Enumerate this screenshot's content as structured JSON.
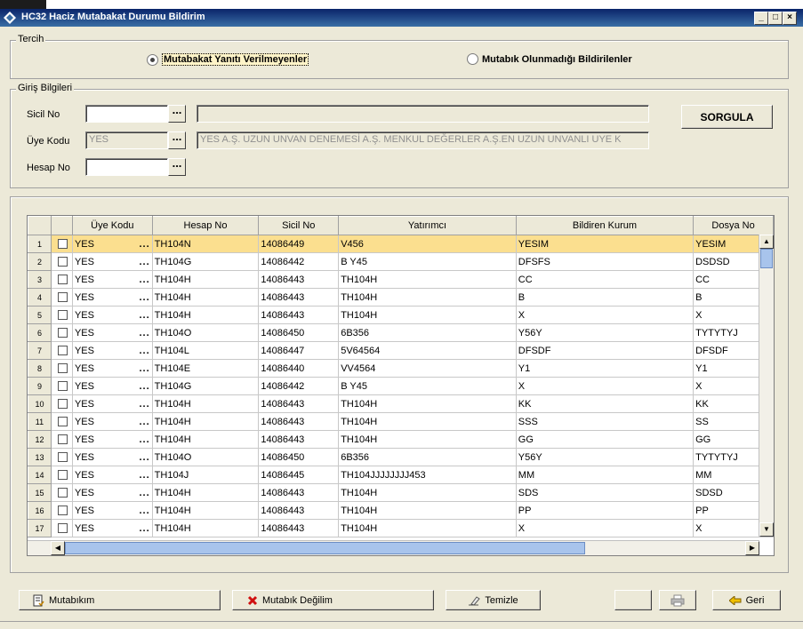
{
  "window": {
    "title": "HC32 Haciz Mutabakat Durumu Bildirim"
  },
  "tercih": {
    "legend": "Tercih",
    "option1": "Mutabakat Yanıtı Verilmeyenler",
    "option2": "Mutabık Olunmadığı Bildirilenler"
  },
  "giris": {
    "legend": "Giriş Bilgileri",
    "sicil_label": "Sicil No",
    "sicil_value": "",
    "sicil_desc": "",
    "uye_label": "Üye Kodu",
    "uye_value": "YES",
    "uye_desc": "YES A.Ş. UZUN UNVAN DENEMESİ A.Ş. MENKUL DEĞERLER A.Ş.EN UZUN UNVANLI UYE K",
    "hesap_label": "Hesap No",
    "hesap_value": "",
    "dots": "...",
    "sorgula": "SORGULA"
  },
  "grid": {
    "columns": [
      "Üye Kodu",
      "Hesap No",
      "Sicil No",
      "Yatırımcı",
      "Bildiren Kurum",
      "Dosya No"
    ],
    "rows": [
      {
        "n": "1",
        "uye": "YES",
        "hesap": "TH104N",
        "sicil": "14086449",
        "yatirimci": "V456",
        "kurum": "YESIM",
        "dosya": "YESIM"
      },
      {
        "n": "2",
        "uye": "YES",
        "hesap": "TH104G",
        "sicil": "14086442",
        "yatirimci": "B Y45",
        "kurum": "DFSFS",
        "dosya": "DSDSD"
      },
      {
        "n": "3",
        "uye": "YES",
        "hesap": "TH104H",
        "sicil": "14086443",
        "yatirimci": "TH104H",
        "kurum": "CC",
        "dosya": "CC"
      },
      {
        "n": "4",
        "uye": "YES",
        "hesap": "TH104H",
        "sicil": "14086443",
        "yatirimci": "TH104H",
        "kurum": "B",
        "dosya": "B"
      },
      {
        "n": "5",
        "uye": "YES",
        "hesap": "TH104H",
        "sicil": "14086443",
        "yatirimci": "TH104H",
        "kurum": "X",
        "dosya": "X"
      },
      {
        "n": "6",
        "uye": "YES",
        "hesap": "TH104O",
        "sicil": "14086450",
        "yatirimci": "6B356",
        "kurum": "Y56Y",
        "dosya": "TYTYTYJ"
      },
      {
        "n": "7",
        "uye": "YES",
        "hesap": "TH104L",
        "sicil": "14086447",
        "yatirimci": "5V64564",
        "kurum": "DFSDF",
        "dosya": "DFSDF"
      },
      {
        "n": "8",
        "uye": "YES",
        "hesap": "TH104E",
        "sicil": "14086440",
        "yatirimci": "VV4564",
        "kurum": "Y1",
        "dosya": "Y1"
      },
      {
        "n": "9",
        "uye": "YES",
        "hesap": "TH104G",
        "sicil": "14086442",
        "yatirimci": "B Y45",
        "kurum": "X",
        "dosya": "X"
      },
      {
        "n": "10",
        "uye": "YES",
        "hesap": "TH104H",
        "sicil": "14086443",
        "yatirimci": "TH104H",
        "kurum": "KK",
        "dosya": "KK"
      },
      {
        "n": "11",
        "uye": "YES",
        "hesap": "TH104H",
        "sicil": "14086443",
        "yatirimci": "TH104H",
        "kurum": "SSS",
        "dosya": "SS"
      },
      {
        "n": "12",
        "uye": "YES",
        "hesap": "TH104H",
        "sicil": "14086443",
        "yatirimci": "TH104H",
        "kurum": "GG",
        "dosya": "GG"
      },
      {
        "n": "13",
        "uye": "YES",
        "hesap": "TH104O",
        "sicil": "14086450",
        "yatirimci": "6B356",
        "kurum": "Y56Y",
        "dosya": "TYTYTYJ"
      },
      {
        "n": "14",
        "uye": "YES",
        "hesap": "TH104J",
        "sicil": "14086445",
        "yatirimci": "TH104JJJJJJJJ453",
        "kurum": "MM",
        "dosya": "MM"
      },
      {
        "n": "15",
        "uye": "YES",
        "hesap": "TH104H",
        "sicil": "14086443",
        "yatirimci": "TH104H",
        "kurum": "SDS",
        "dosya": "SDSD"
      },
      {
        "n": "16",
        "uye": "YES",
        "hesap": "TH104H",
        "sicil": "14086443",
        "yatirimci": "TH104H",
        "kurum": "PP",
        "dosya": "PP"
      },
      {
        "n": "17",
        "uye": "YES",
        "hesap": "TH104H",
        "sicil": "14086443",
        "yatirimci": "TH104H",
        "kurum": "X",
        "dosya": "X"
      }
    ]
  },
  "buttons": {
    "mutabikim": "Mutabıkım",
    "mutabik_degilim": "Mutabık Değilim",
    "temizle": "Temizle",
    "geri": "Geri"
  },
  "icons": {
    "app": "app-icon",
    "mutabikim": "document-check-icon",
    "mutabik_degilim": "red-x-icon",
    "temizle": "eraser-icon",
    "print": "printer-icon",
    "geri": "arrow-left-icon"
  },
  "colors": {
    "selected_row": "#fbdf8f",
    "title_bar": "#0a246a"
  }
}
